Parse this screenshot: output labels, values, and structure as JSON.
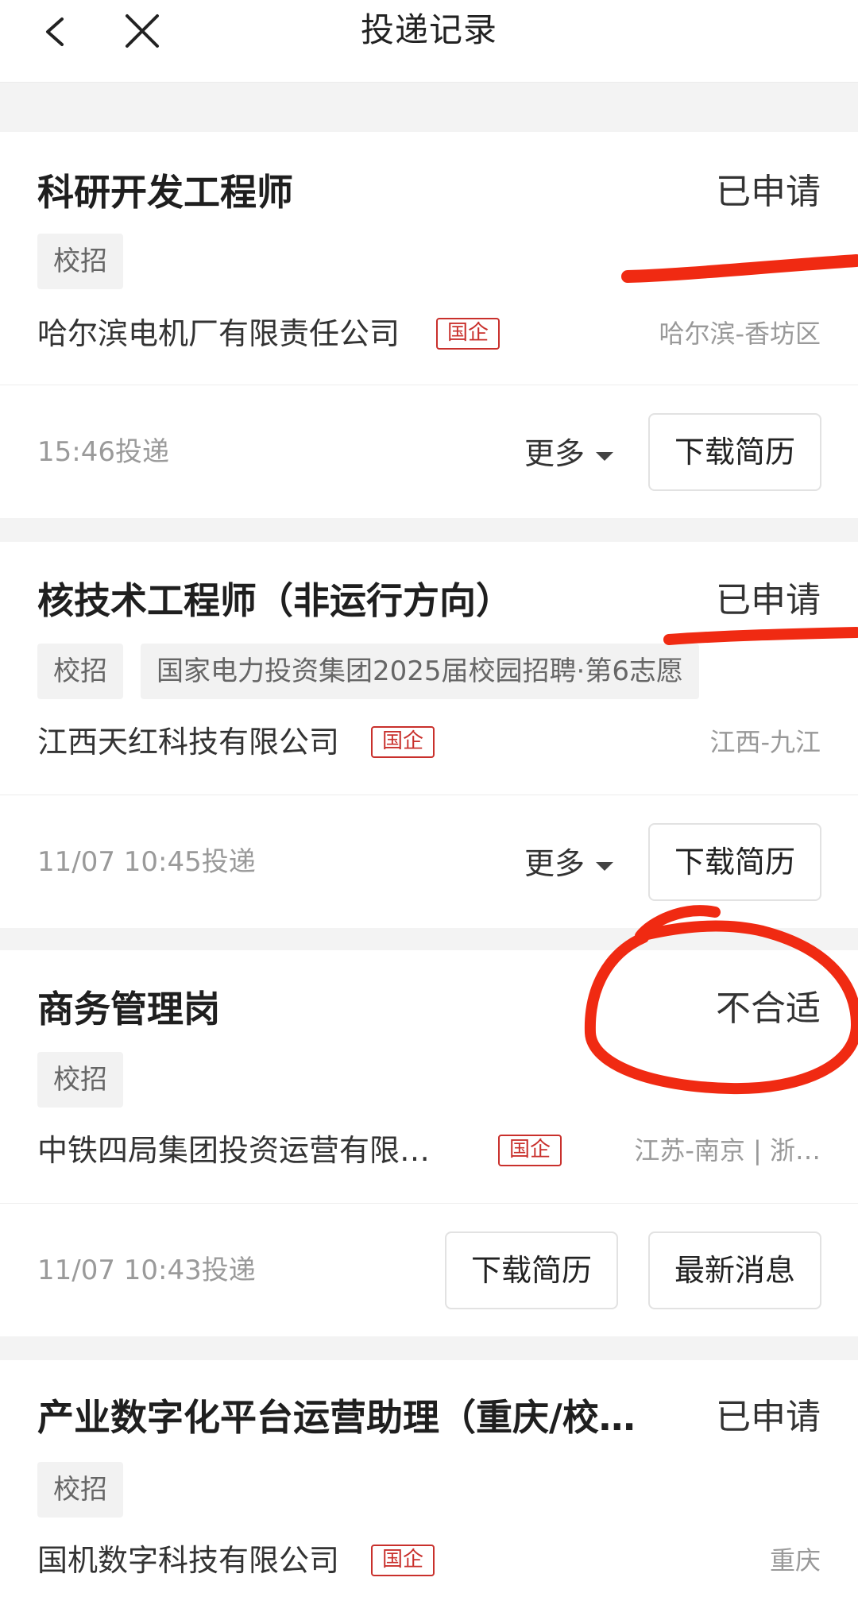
{
  "header": {
    "title": "投递记录"
  },
  "records": [
    {
      "job_title": "科研开发工程师",
      "status": "已申请",
      "tags": [
        "校招"
      ],
      "company": "哈尔滨电机厂有限责任公司",
      "company_badge": "国企",
      "location": "哈尔滨-香坊区",
      "time": "15:46投递",
      "more_label": "更多",
      "buttons": [
        "下载简历"
      ]
    },
    {
      "job_title": "核技术工程师（非运行方向）",
      "status": "已申请",
      "tags": [
        "校招",
        "国家电力投资集团2025届校园招聘·第6志愿"
      ],
      "company": "江西天红科技有限公司",
      "company_badge": "国企",
      "location": "江西-九江",
      "time": "11/07 10:45投递",
      "more_label": "更多",
      "buttons": [
        "下载简历"
      ]
    },
    {
      "job_title": "商务管理岗",
      "status": "不合适",
      "tags": [
        "校招"
      ],
      "company": "中铁四局集团投资运营有限…",
      "company_badge": "国企",
      "location": "江苏-南京 | 浙…",
      "time": "11/07 10:43投递",
      "buttons": [
        "下载简历",
        "最新消息"
      ]
    },
    {
      "job_title": "产业数字化平台运营助理（重庆/校…",
      "status": "已申请",
      "tags": [
        "校招"
      ],
      "company": "国机数字科技有限公司",
      "company_badge": "国企",
      "location": "重庆"
    }
  ],
  "colors": {
    "annotation_red": "#f02a12",
    "badge_red": "#c9302c"
  }
}
